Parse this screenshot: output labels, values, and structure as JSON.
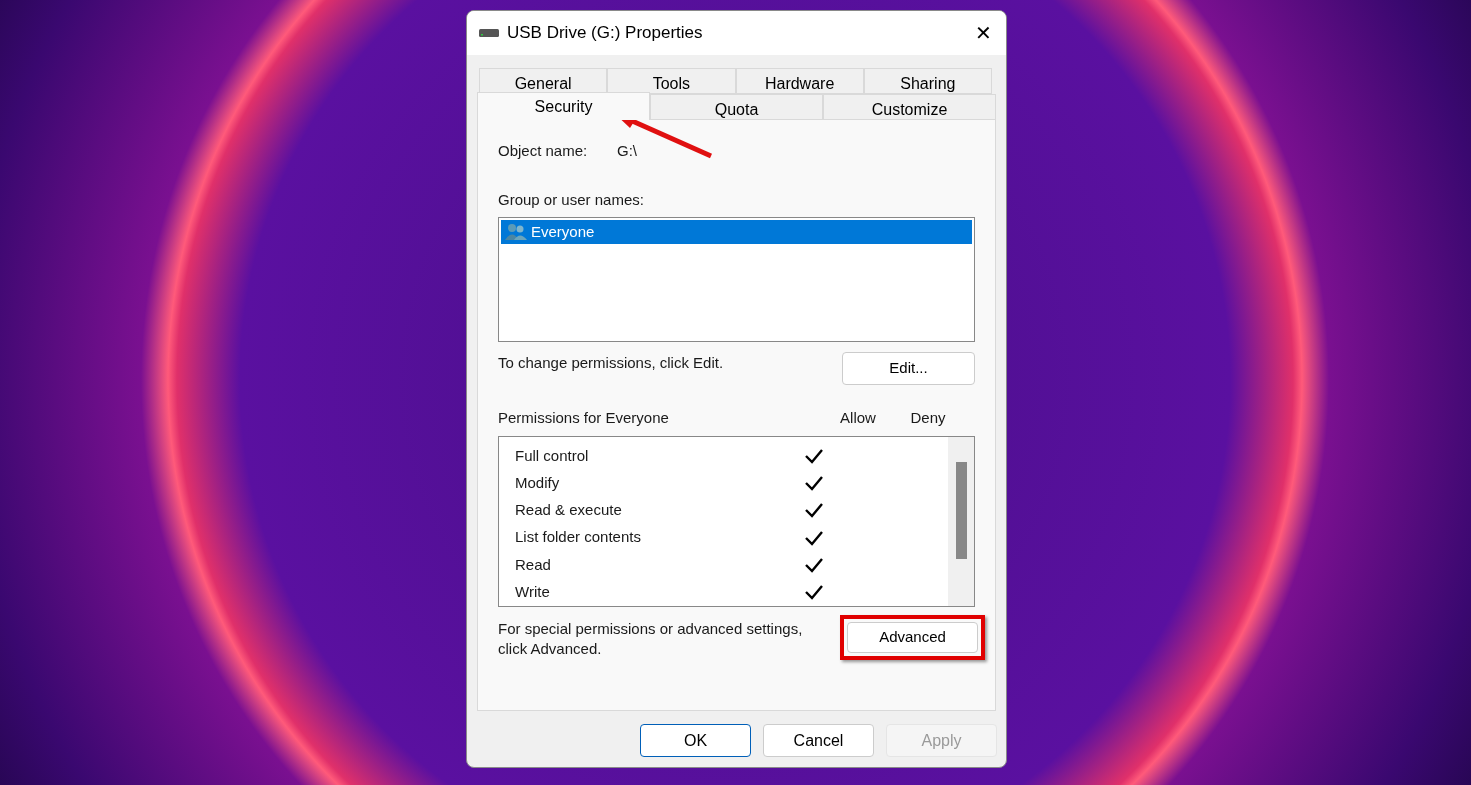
{
  "window": {
    "title": "USB Drive (G:) Properties",
    "close": "✕"
  },
  "tab_rows": [
    [
      {
        "label": "General",
        "selected": false
      },
      {
        "label": "Tools",
        "selected": false
      },
      {
        "label": "Hardware",
        "selected": false
      },
      {
        "label": "Sharing",
        "selected": false
      }
    ],
    [
      {
        "label": "Security",
        "selected": true
      },
      {
        "label": "Quota",
        "selected": false
      },
      {
        "label": "Customize",
        "selected": false
      }
    ]
  ],
  "object_name": {
    "label": "Object name:",
    "value": "G:\\"
  },
  "groups": {
    "label": "Group or user names:",
    "items": [
      {
        "name": "Everyone",
        "selected": true
      }
    ]
  },
  "change_hint": "To change permissions, click Edit.",
  "edit_button": "Edit...",
  "permissions": {
    "title": "Permissions for Everyone",
    "allow_header": "Allow",
    "deny_header": "Deny",
    "rows": [
      {
        "name": "Full control",
        "allow": true,
        "deny": false
      },
      {
        "name": "Modify",
        "allow": true,
        "deny": false
      },
      {
        "name": "Read & execute",
        "allow": true,
        "deny": false
      },
      {
        "name": "List folder contents",
        "allow": true,
        "deny": false
      },
      {
        "name": "Read",
        "allow": true,
        "deny": false
      },
      {
        "name": "Write",
        "allow": true,
        "deny": false
      }
    ]
  },
  "advanced_hint": "For special permissions or advanced settings, click Advanced.",
  "advanced_button": "Advanced",
  "buttons": [
    {
      "label": "OK",
      "default": true,
      "disabled": false
    },
    {
      "label": "Cancel",
      "default": false,
      "disabled": false
    },
    {
      "label": "Apply",
      "default": false,
      "disabled": true
    }
  ]
}
